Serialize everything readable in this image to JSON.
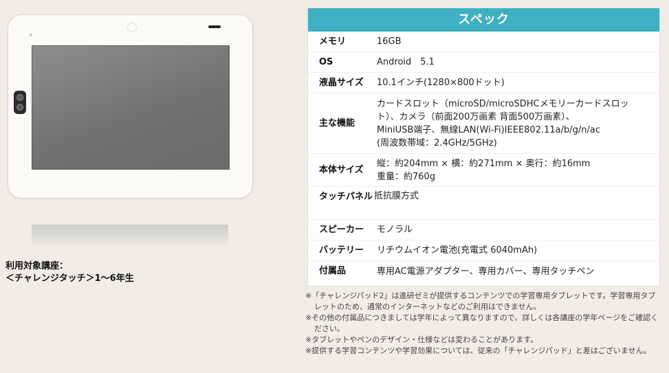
{
  "target": {
    "heading": "利用対象講座：",
    "course": "＜チャレンジタッチ＞1～6年生"
  },
  "spec": {
    "title": "スペック",
    "rows": [
      {
        "key": "メモリ",
        "value": [
          "16GB"
        ]
      },
      {
        "key": "OS",
        "value": [
          "Android　5.1"
        ]
      },
      {
        "key": "液晶サイズ",
        "value": [
          "10.1インチ(1280×800ドット)"
        ]
      },
      {
        "key": "主な機能",
        "value": [
          "カードスロット（microSD/microSDHCメモリーカードスロッ",
          "ト）、カメラ（前面200万画素 背面500万画素）、",
          "MiniUSB端子、無線LAN(Wi-Fi)IEEE802.11a/b/g/n/ac",
          "(周波数帯域：2.4GHz/5GHz)"
        ]
      },
      {
        "key": "本体サイズ",
        "value": [
          "縦：約204mm × 横：約271mm × 奥行：約16mm",
          "重量：約760g"
        ]
      },
      {
        "key": "タッチパネル",
        "value": [
          "抵抗膜方式"
        ]
      },
      {
        "key": "スピーカー",
        "value": [
          "モノラル"
        ]
      },
      {
        "key": "バッテリー",
        "value": [
          "リチウムイオン電池(充電式 6040mAh)"
        ]
      },
      {
        "key": "付属品",
        "value": [
          "専用AC電源アダプター、専用カバー、専用タッチペン"
        ]
      }
    ]
  },
  "notes": [
    "※「チャレンジパッド2」は進研ゼミが提供するコンテンツでの学習専用タブレットです。学習専用タブレットのため、通常のインターネットなどのご利用はできません。",
    "※その他の付属品につきましては学年によって異なりますので、詳しくは各講座の学年ページをご確認ください。",
    "※タブレットやペンのデザイン・仕様などは変わることがあります。",
    "※提供する学習コンテンツや学習効果については、従来の「チャレンジパッド」と差はございません。"
  ],
  "colors": {
    "header_bg": "#3fb0c4",
    "page_bg": "#efede6"
  }
}
